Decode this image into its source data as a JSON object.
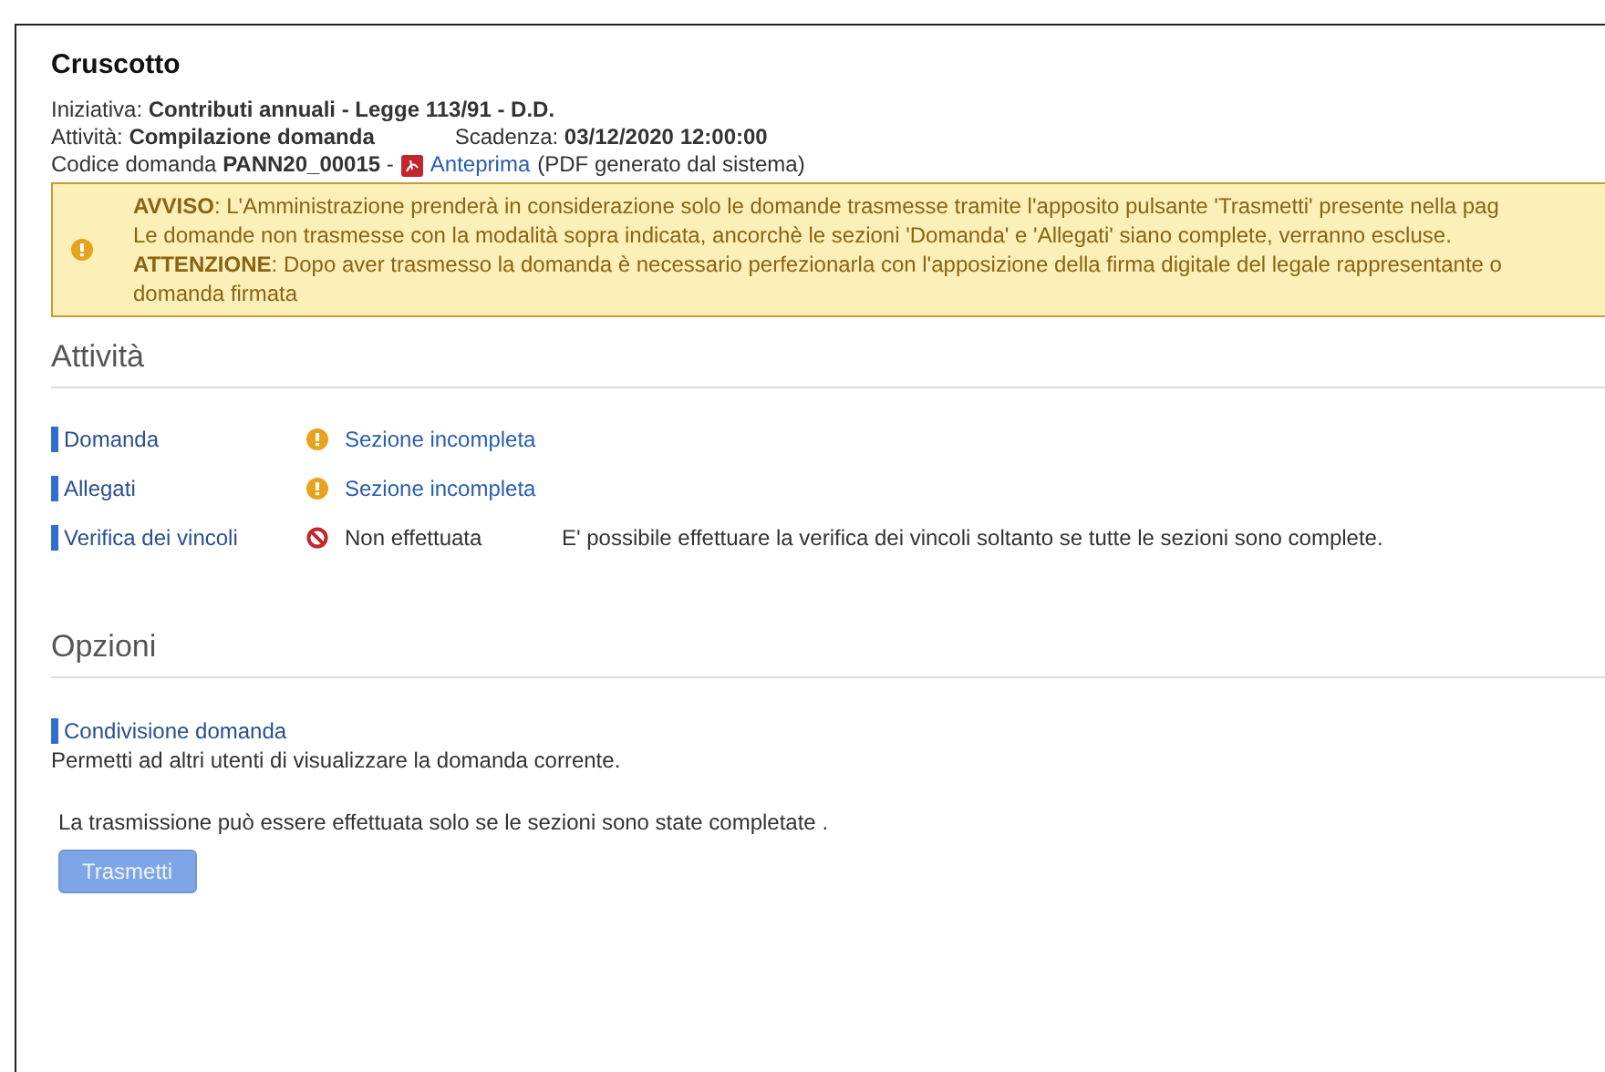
{
  "title": "Cruscotto",
  "info": {
    "iniziativa": "Iniziativa: **Contributi annuali - Legge 113/91 - D.D.**",
    "attivita": "Attività: **Compilazione domanda**",
    "scadenza": "Scadenza: **03/12/2020 12:00:00**",
    "codice": "Codice domanda **PANN20_00015** -",
    "preview_link": "Anteprima",
    "preview_note": "(PDF generato dal sistema)"
  },
  "alert": {
    "lines": [
      "**AVVISO**: L'Amministrazione prenderà in considerazione solo le domande trasmesse tramite l'apposito pulsante 'Trasmetti' presente nella pag",
      "Le domande non trasmesse con la modalità sopra indicata, ancorchè le sezioni 'Domanda' e 'Allegati' siano complete, verranno escluse.",
      "**ATTENZIONE**: Dopo aver trasmesso la domanda è necessario perfezionarla con l'apposizione della firma digitale del legale rappresentante o",
      "domanda firmata"
    ]
  },
  "activities": {
    "heading": "Attività",
    "rows": [
      {
        "name": "Domanda",
        "kind": "warning",
        "status": "Sezione incompleta"
      },
      {
        "name": "Allegati",
        "kind": "warning",
        "status": "Sezione incompleta"
      },
      {
        "name": "Verifica dei vincoli",
        "kind": "error",
        "status": "Non effettuata",
        "note": "E' possibile effettuare la verifica dei vincoli soltanto se tutte le sezioni sono complete."
      }
    ]
  },
  "options": {
    "heading": "Opzioni",
    "share_title": "Condivisione domanda",
    "share_desc": "Permetti ad altri utenti di visualizzare la domanda corrente.",
    "transmit_note": "La trasmissione può essere effettuata solo se le sezioni sono state completate .",
    "transmit_button": {
      "label": "Trasmetti",
      "disabled": true
    }
  }
}
